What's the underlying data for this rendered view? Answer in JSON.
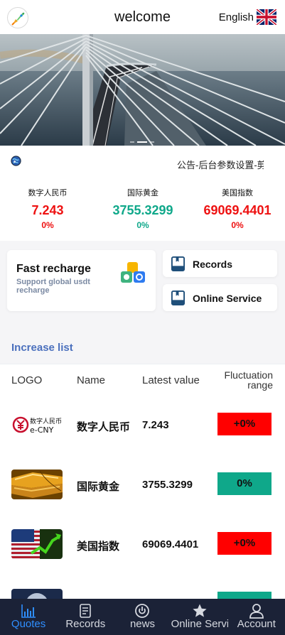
{
  "header": {
    "title": "welcome",
    "language": "English",
    "logo_icon": "rocket-icon",
    "flag_icon": "uk-flag-icon"
  },
  "banner": {
    "image": "cable-stayed-bridge-over-sea",
    "slide_count": 3,
    "active_slide": 2
  },
  "notice": {
    "icon": "globe-icon",
    "text": "公告-后台参数设置-剪"
  },
  "stats": [
    {
      "name": "数字人民币",
      "value": "7.243",
      "change": "0%",
      "trend": "up"
    },
    {
      "name": "国际黄金",
      "value": "3755.3299",
      "change": "0%",
      "trend": "flat"
    },
    {
      "name": "美国指数",
      "value": "69069.4401",
      "change": "0%",
      "trend": "up"
    }
  ],
  "cards": {
    "fast_recharge": {
      "title": "Fast recharge",
      "subtitle": "Support global usdt recharge",
      "icon": "apps-icon"
    },
    "records": {
      "label": "Records",
      "icon": "book-icon"
    },
    "online_service": {
      "label": "Online Service",
      "icon": "book-icon"
    }
  },
  "list": {
    "title": "Increase list",
    "columns": {
      "logo": "LOGO",
      "name": "Name",
      "latest": "Latest value",
      "range": "Fluctuation range"
    },
    "rows": [
      {
        "logo": "e-cny-logo",
        "name": "数字人民币",
        "value": "7.243",
        "change": "+0%",
        "trend": "up"
      },
      {
        "logo": "gold-bars-image",
        "name": "国际黄金",
        "value": "3755.3299",
        "change": "0%",
        "trend": "flat"
      },
      {
        "logo": "us-flag-chart-image",
        "name": "美国指数",
        "value": "69069.4401",
        "change": "+0%",
        "trend": "up"
      },
      {
        "logo": "moon-image",
        "name": "",
        "value": "",
        "change": "",
        "trend": "flat"
      }
    ]
  },
  "tabbar": [
    {
      "label": "Quotes",
      "icon": "chart-icon",
      "active": true
    },
    {
      "label": "Records",
      "icon": "document-icon",
      "active": false
    },
    {
      "label": "news",
      "icon": "power-icon",
      "active": false
    },
    {
      "label": "Online Servi",
      "icon": "star-icon",
      "active": false
    },
    {
      "label": "Account",
      "icon": "user-icon",
      "active": false
    }
  ],
  "colors": {
    "up": "#ee1111",
    "flat": "#0fa88a",
    "up_badge": "#ff0000",
    "flat_badge": "#0fa88a",
    "accent": "#2f8fff",
    "tabbar_bg": "#1b2237",
    "section_title": "#4b70bd"
  },
  "e_cny_text": {
    "line1": "数字人民币",
    "line2": "e-CNY"
  }
}
